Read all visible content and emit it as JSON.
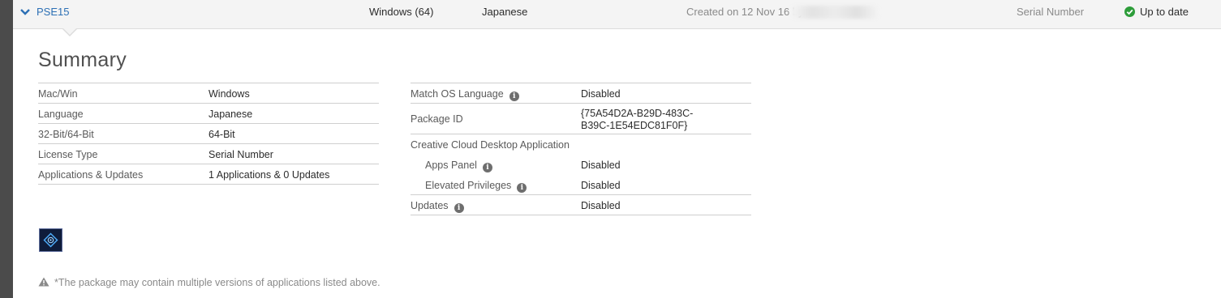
{
  "header": {
    "package_name": "PSE15",
    "os": "Windows (64)",
    "language": "Japanese",
    "created": "Created on 12 Nov 16 by",
    "license": "Serial Number",
    "status": "Up to date",
    "status_color": "#2d9d3a",
    "link_color": "#2d70b5"
  },
  "summary": {
    "title": "Summary",
    "left_rows": [
      {
        "label": "Mac/Win",
        "value": "Windows"
      },
      {
        "label": "Language",
        "value": "Japanese"
      },
      {
        "label": "32-Bit/64-Bit",
        "value": "64-Bit"
      },
      {
        "label": "License Type",
        "value": "Serial Number"
      },
      {
        "label": "Applications & Updates",
        "value": "1 Applications & 0 Updates"
      }
    ],
    "right_rows": {
      "match_os": {
        "label": "Match OS Language",
        "value": "Disabled"
      },
      "package_id": {
        "label": "Package ID",
        "value": "{75A54D2A-B29D-483C-B39C-1E54EDC81F0F}"
      },
      "ccda": {
        "label": "Creative Cloud Desktop Application"
      },
      "apps_panel": {
        "label": "Apps Panel",
        "value": "Disabled"
      },
      "elevated": {
        "label": "Elevated Privileges",
        "value": "Disabled"
      },
      "updates": {
        "label": "Updates",
        "value": "Disabled"
      }
    }
  },
  "icons": {
    "expand": "chevron-down-icon",
    "status": "check-circle-icon",
    "info": "info-icon",
    "app": "photoshop-elements-app-icon",
    "warning": "warning-icon"
  },
  "footnote": "*The package may contain multiple versions of applications listed above."
}
